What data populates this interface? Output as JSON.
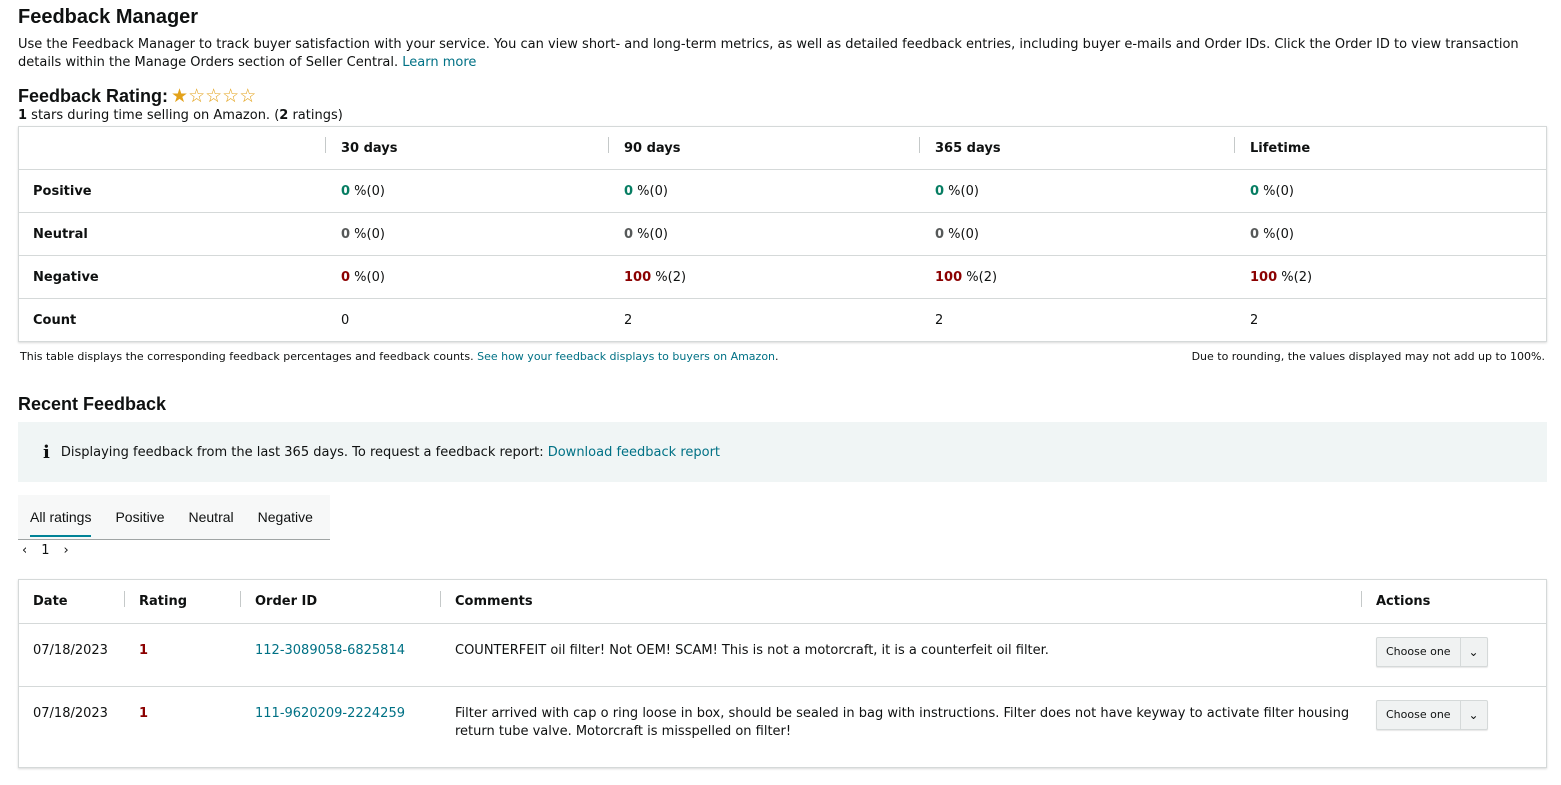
{
  "page": {
    "title": "Feedback Manager",
    "intro": "Use the Feedback Manager to track buyer satisfaction with your service. You can view short- and long-term metrics, as well as detailed feedback entries, including buyer e-mails and Order IDs. Click the Order ID to view transaction details within the Manage Orders section of Seller Central.",
    "learn_more": "Learn more"
  },
  "rating": {
    "heading": "Feedback Rating:",
    "stars_filled": 1,
    "stars_total": 5,
    "summary_value": "1",
    "summary_text1": " stars during time selling on Amazon. (",
    "summary_count": "2",
    "summary_text2": " ratings)"
  },
  "metrics": {
    "columns": [
      "30 days",
      "90 days",
      "365 days",
      "Lifetime"
    ],
    "rows": [
      {
        "label": "Positive",
        "cells": [
          {
            "pct": "0",
            "cnt": " %(0)"
          },
          {
            "pct": "0",
            "cnt": " %(0)"
          },
          {
            "pct": "0",
            "cnt": " %(0)"
          },
          {
            "pct": "0",
            "cnt": " %(0)"
          }
        ]
      },
      {
        "label": "Neutral",
        "cells": [
          {
            "pct": "0",
            "cnt": " %(0)"
          },
          {
            "pct": "0",
            "cnt": " %(0)"
          },
          {
            "pct": "0",
            "cnt": " %(0)"
          },
          {
            "pct": "0",
            "cnt": " %(0)"
          }
        ]
      },
      {
        "label": "Negative",
        "cells": [
          {
            "pct": "0",
            "cnt": " %(0)"
          },
          {
            "pct": "100",
            "cnt": " %(2)"
          },
          {
            "pct": "100",
            "cnt": " %(2)"
          },
          {
            "pct": "100",
            "cnt": " %(2)"
          }
        ]
      },
      {
        "label": "Count",
        "cells": [
          {
            "pct": "",
            "cnt": "0"
          },
          {
            "pct": "",
            "cnt": "2"
          },
          {
            "pct": "",
            "cnt": "2"
          },
          {
            "pct": "",
            "cnt": "2"
          }
        ]
      }
    ],
    "footnote_left": "This table displays the corresponding feedback percentages and feedback counts.",
    "footnote_link": "See how your feedback displays to buyers on Amazon",
    "footnote_right": "Due to rounding, the values displayed may not add up to 100%."
  },
  "recent": {
    "heading": "Recent Feedback",
    "info_text": "Displaying feedback from the last 365 days. To request a feedback report:",
    "info_link": "Download feedback report",
    "tabs": [
      "All ratings",
      "Positive",
      "Neutral",
      "Negative"
    ],
    "page": "1",
    "columns": [
      "Date",
      "Rating",
      "Order ID",
      "Comments",
      "Actions"
    ],
    "rows": [
      {
        "date": "07/18/2023",
        "rating": "1",
        "order": "112-3089058-6825814",
        "comment": "COUNTERFEIT oil filter! Not OEM! SCAM! This is not a motorcraft, it is a counterfeit oil filter.",
        "action": "Choose one"
      },
      {
        "date": "07/18/2023",
        "rating": "1",
        "order": "111-9620209-2224259",
        "comment": "Filter arrived with cap o ring loose in box, should be sealed in bag with instructions. Filter does not have keyway to activate filter housing return tube valve. Motorcraft is misspelled on filter!",
        "action": "Choose one"
      }
    ]
  },
  "colors": {
    "positive": "#067d62",
    "neutral": "#565959",
    "negative": "#b12704",
    "link": "#007185",
    "tab_accent": "#008296"
  }
}
